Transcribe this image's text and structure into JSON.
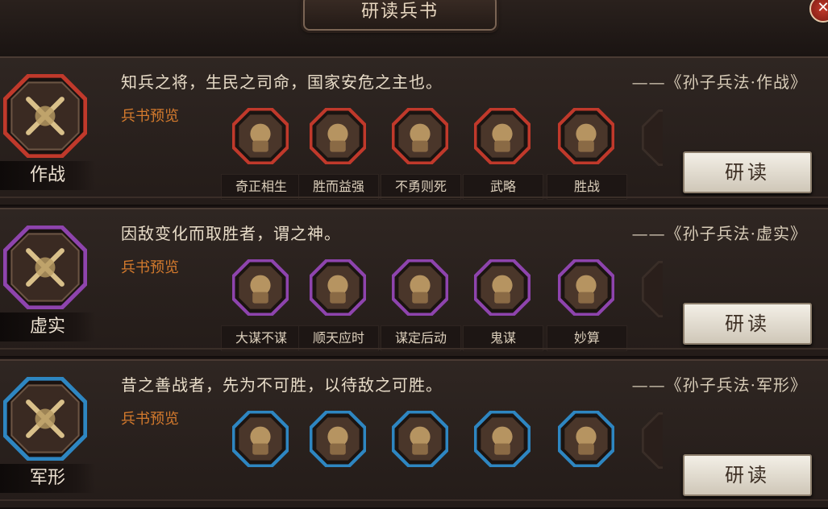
{
  "window": {
    "title": "研读兵书",
    "close_icon": "close-icon"
  },
  "sections": [
    {
      "name": "作战",
      "theme": "#c0392b",
      "badge_icon": "crossed-blades-icon",
      "quote": "知兵之将，生民之司命，国家安危之主也。",
      "source": "——《孙子兵法·作战》",
      "preview_label": "兵书预览",
      "items": [
        {
          "label": "奇正相生",
          "icon": "warrior-icon"
        },
        {
          "label": "胜而益强",
          "icon": "general-icon"
        },
        {
          "label": "不勇则死",
          "icon": "fighter-icon"
        },
        {
          "label": "武略",
          "icon": "sword-icon"
        },
        {
          "label": "胜战",
          "icon": "scroll-icon"
        }
      ],
      "button": "研读"
    },
    {
      "name": "虚实",
      "theme": "#8e44ad",
      "badge_icon": "broken-banner-icon",
      "quote": "因敌变化而取胜者，谓之神。",
      "source": "——《孙子兵法·虚实》",
      "preview_label": "兵书预览",
      "items": [
        {
          "label": "大谋不谋",
          "icon": "strategist-icon"
        },
        {
          "label": "顺天应时",
          "icon": "banner-icon"
        },
        {
          "label": "谋定后动",
          "icon": "commander-icon"
        },
        {
          "label": "鬼谋",
          "icon": "hooded-advisor-icon"
        },
        {
          "label": "妙算",
          "icon": "scroll-icon"
        }
      ],
      "button": "研读"
    },
    {
      "name": "军形",
      "theme": "#2e86c1",
      "badge_icon": "shield-arrows-icon",
      "quote": "昔之善战者，先为不可胜，以待敌之可胜。",
      "source": "——《孙子兵法·军形》",
      "preview_label": "兵书预览",
      "items": [
        {
          "label": "",
          "icon": "soldiers-icon"
        },
        {
          "label": "",
          "icon": "lotus-icon"
        },
        {
          "label": "",
          "icon": "horse-icon"
        },
        {
          "label": "",
          "icon": "chalice-icon"
        },
        {
          "label": "",
          "icon": "scholar-icon"
        }
      ],
      "button": "研读"
    }
  ]
}
